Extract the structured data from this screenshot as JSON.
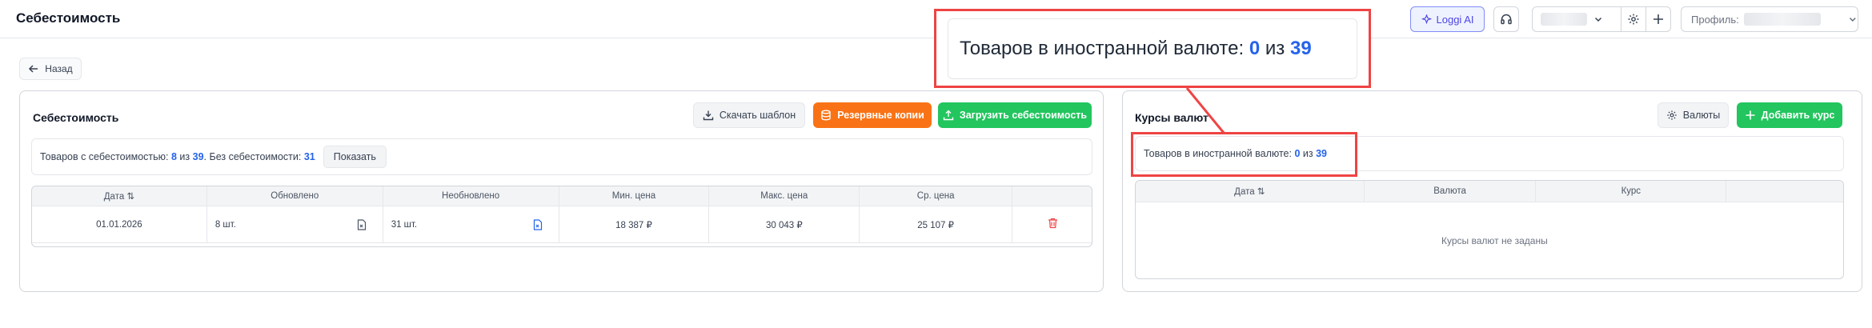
{
  "header": {
    "title": "Себестоимость",
    "ai_label": "Loggi AI",
    "profile_label": "Профиль:"
  },
  "back_label": "Назад",
  "cost_card": {
    "title": "Себестоимость",
    "download_label": "Скачать шаблон",
    "backup_label": "Резервные копии",
    "upload_label": "Загрузить себестоимость",
    "info": {
      "prefix": "Товаров с себестоимостью:",
      "count": "8",
      "of": "из",
      "total": "39",
      "dot": ".",
      "without_label": "Без себестоимости:",
      "without_count": "31",
      "show_label": "Показать"
    },
    "columns": [
      "Дата",
      "Обновлено",
      "Необновлено",
      "Мин. цена",
      "Макс. цена",
      "Ср. цена",
      ""
    ],
    "rows": [
      {
        "date": "01.01.2026",
        "updated": "8 шт.",
        "not_updated": "31 шт.",
        "min": "18 387 ₽",
        "max": "30 043 ₽",
        "avg": "25 107 ₽"
      }
    ]
  },
  "rates_card": {
    "title": "Курсы валют",
    "currencies_label": "Валюты",
    "add_label": "Добавить курс",
    "info": {
      "prefix": "Товаров в иностранной валюте:",
      "count": "0",
      "of": "из",
      "total": "39"
    },
    "columns": [
      "Дата",
      "Валюта",
      "Курс",
      ""
    ],
    "empty": "Курсы валют не заданы"
  },
  "zoom": {
    "prefix": "Товаров в иностранной валюте:",
    "count": "0",
    "of": "из",
    "total": "39"
  },
  "colors": {
    "accent_blue": "#2563eb",
    "orange": "#f97316",
    "green": "#22c55e",
    "highlight_red": "#ef4444"
  }
}
